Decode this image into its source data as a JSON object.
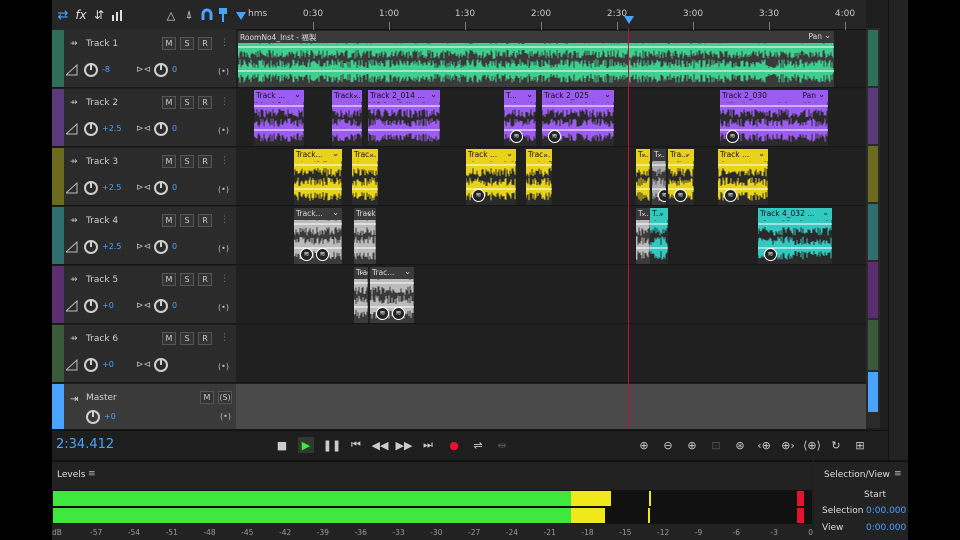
{
  "toolbar": {
    "icons": [
      "multitrack-switch-icon",
      "fx-icon",
      "routing-icon",
      "envelope-icon",
      "metronome-icon",
      "snap-icon",
      "marker-icon"
    ],
    "fx_label": "fx"
  },
  "ruler": {
    "unit_label": "hms",
    "ticks": [
      "0:30",
      "1:00",
      "1:30",
      "2:00",
      "2:30",
      "3:00",
      "3:30",
      "4:00"
    ]
  },
  "tracks": [
    {
      "name": "Track 1",
      "volume": "-8",
      "pan": "0",
      "color": "#2f6f5a"
    },
    {
      "name": "Track 2",
      "volume": "+2.5",
      "pan": "0",
      "color": "#5b3a7a"
    },
    {
      "name": "Track 3",
      "volume": "+2.5",
      "pan": "0",
      "color": "#6b6a1e"
    },
    {
      "name": "Track 4",
      "volume": "+2.5",
      "pan": "0",
      "color": "#2f6f6f"
    },
    {
      "name": "Track 5",
      "volume": "+0",
      "pan": "0",
      "color": "#5b2f6f"
    },
    {
      "name": "Track 6",
      "volume": "+0",
      "pan": "",
      "color": "#3a5a3a"
    }
  ],
  "buttons": {
    "mute": "M",
    "solo": "S",
    "record": "R"
  },
  "master": {
    "name": "Master",
    "volume": "+0",
    "mute": "M",
    "solo": "(S)"
  },
  "clips": {
    "track1": [
      {
        "title": "RoomNo4_Inst - 福製",
        "pan": "Pan"
      }
    ],
    "track2": [
      "Track ...",
      "Track...",
      "Track 2_014 ...",
      "T...",
      "Track 2_025",
      "Track 2_030"
    ],
    "track2_pan": "Pan",
    "track3": [
      "Track...",
      "Trac...",
      "Track ...",
      "Trac...",
      "T...",
      "Tra...",
      "Track ..."
    ],
    "track4": [
      "Track...",
      "T...",
      "Track 4_032 ..."
    ],
    "track5": [
      "Trac..."
    ]
  },
  "transport": {
    "timecode": "2:34.412"
  },
  "levels": {
    "title": "Levels",
    "scale": [
      "dB",
      "-57",
      "-54",
      "-51",
      "-48",
      "-45",
      "-42",
      "-39",
      "-36",
      "-33",
      "-30",
      "-27",
      "-24",
      "-21",
      "-18",
      "-15",
      "-12",
      "-9",
      "-6",
      "-3",
      "0"
    ]
  },
  "selection_view": {
    "title": "Selection/View",
    "col_start": "Start",
    "row_selection": "Selection",
    "row_view": "View",
    "selection_start": "0:00.000",
    "view_start": "0:00.000"
  },
  "colors": {
    "accent": "#4aa3ff",
    "track1_clip": "#3ecf8e",
    "track2_clip": "#9d5cf0",
    "track3_clip": "#e8d31a",
    "track4_clip": "#33c9c0",
    "playhead": "#c8102e",
    "level_green": "#3ee83e",
    "level_yellow": "#f0e81a",
    "level_red": "#e8102e"
  }
}
